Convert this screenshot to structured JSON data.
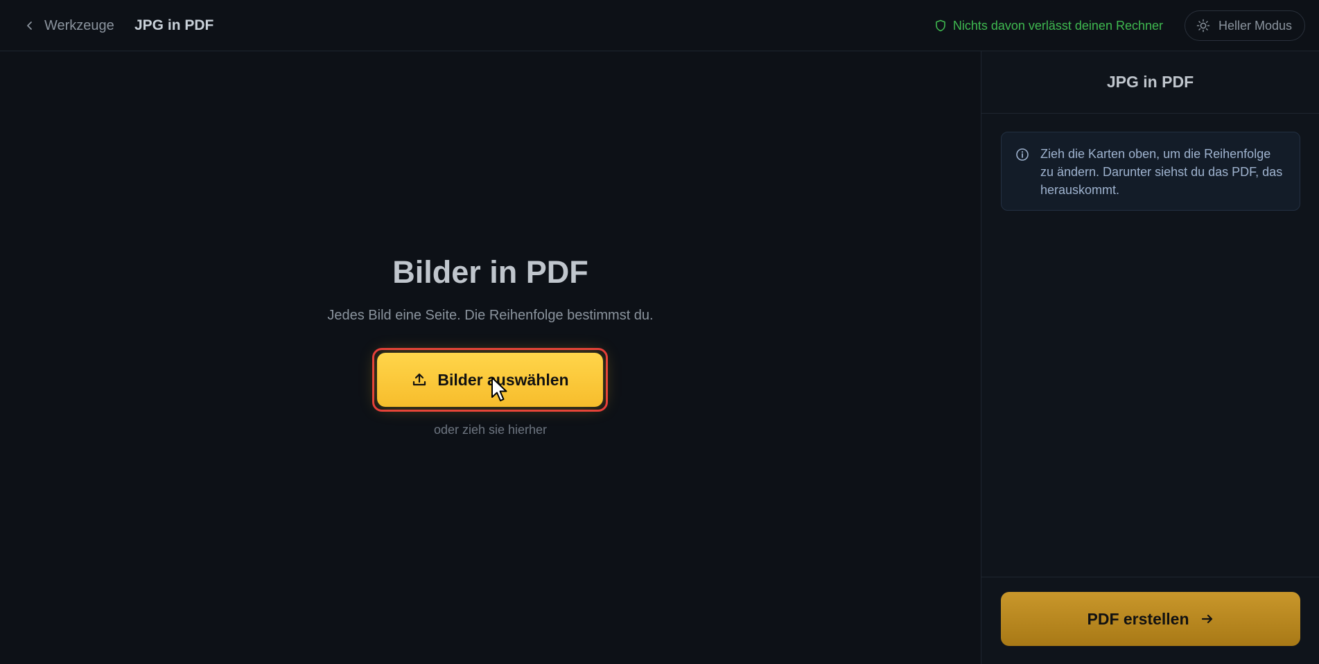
{
  "header": {
    "back_label": "Werkzeuge",
    "title": "JPG in PDF",
    "privacy_text": "Nichts davon verlässt deinen Rechner",
    "mode_toggle_label": "Heller Modus"
  },
  "main": {
    "title": "Bilder in PDF",
    "subtitle": "Jedes Bild eine Seite. Die Reihenfolge bestimmst du.",
    "select_button_label": "Bilder auswählen",
    "drop_hint": "oder zieh sie hierher"
  },
  "sidebar": {
    "title": "JPG in PDF",
    "info_text": "Zieh die Karten oben, um die Reihenfolge zu ändern. Darunter siehst du das PDF, das herauskommt.",
    "create_button_label": "PDF erstellen"
  },
  "colors": {
    "background": "#0d1117",
    "accent": "#fbc93b",
    "privacy_green": "#3fb950",
    "highlight_outline": "#e5383b"
  },
  "icons": [
    "chevron-left-icon",
    "shield-icon",
    "sun-icon",
    "upload-icon",
    "info-icon",
    "arrow-right-icon",
    "mouse-cursor-icon"
  ]
}
